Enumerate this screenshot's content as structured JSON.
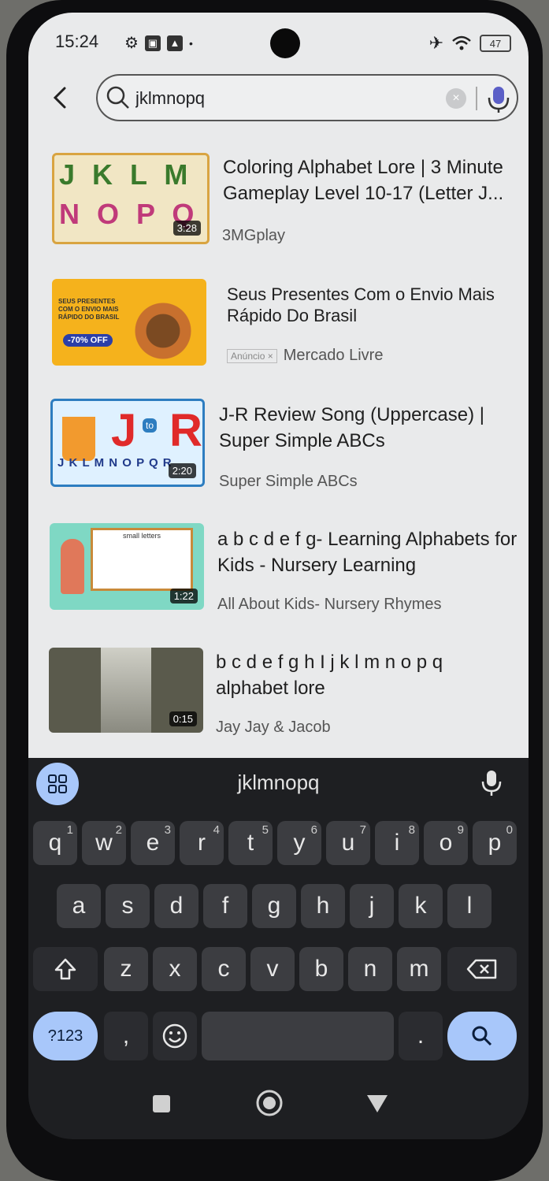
{
  "status_bar": {
    "time": "15:24",
    "battery": "47"
  },
  "search": {
    "query": "jklmnopq"
  },
  "results": [
    {
      "title": "Coloring Alphabet Lore | 3 Minute Gameplay Level 10-17 (Letter J...",
      "channel": "3MGplay",
      "duration": "3:28",
      "thumb_letters_top": "J K L M",
      "thumb_letters_bottom": "N O P Q"
    },
    {
      "title": "Seus Presentes Com o Envio Mais Rápido Do Brasil",
      "channel": "Mercado Livre",
      "ad_badge": "Anúncio ×",
      "thumb_text": "SEUS PRESENTES COM O ENVIO MAIS RÁPIDO DO BRASIL",
      "thumb_discount": "-70% OFF"
    },
    {
      "title": "J-R Review Song (Uppercase) | Super Simple ABCs",
      "channel": "Super Simple ABCs",
      "duration": "2:20",
      "thumb_big": "J",
      "thumb_to": "to",
      "thumb_big2": "R",
      "thumb_row": "J K L M N O P Q R"
    },
    {
      "title": "a b c d e f g- Learning Alphabets for Kids - Nursery Learning",
      "channel": "All About Kids- Nursery Rhymes",
      "duration": "1:22",
      "thumb_board_title": "small letters"
    },
    {
      "title": "b c d e f g h I j k l m n o p q alphabet lore",
      "channel": "Jay Jay & Jacob",
      "duration": "0:15"
    }
  ],
  "keyboard": {
    "suggestion": "jklmnopq",
    "row1": [
      "q",
      "w",
      "e",
      "r",
      "t",
      "y",
      "u",
      "i",
      "o",
      "p"
    ],
    "row1_nums": [
      "1",
      "2",
      "3",
      "4",
      "5",
      "6",
      "7",
      "8",
      "9",
      "0"
    ],
    "row2": [
      "a",
      "s",
      "d",
      "f",
      "g",
      "h",
      "j",
      "k",
      "l"
    ],
    "row3": [
      "z",
      "x",
      "c",
      "v",
      "b",
      "n",
      "m"
    ],
    "symbols_key": "?123",
    "comma_key": ",",
    "period_key": "."
  }
}
